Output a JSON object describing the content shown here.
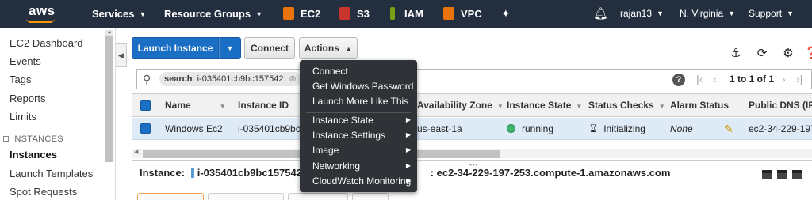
{
  "topnav": {
    "logo": "aws",
    "services": "Services",
    "resource_groups": "Resource Groups",
    "ec2": "EC2",
    "s3": "S3",
    "iam": "IAM",
    "vpc": "VPC",
    "user": "rajan13",
    "region": "N. Virginia",
    "support": "Support"
  },
  "sidebar": {
    "items": [
      "EC2 Dashboard",
      "Events",
      "Tags",
      "Reports",
      "Limits"
    ],
    "section": "INSTANCES",
    "section_items": [
      "Instances",
      "Launch Templates",
      "Spot Requests"
    ]
  },
  "toolbar": {
    "launch": "Launch Instance",
    "connect": "Connect",
    "actions": "Actions"
  },
  "search": {
    "chip_key": "search",
    "chip_value": ": i-035401cb9bc157542"
  },
  "pager": {
    "text": "1 to 1 of 1"
  },
  "table": {
    "headers": [
      "Name",
      "Instance ID",
      "Availability Zone",
      "Instance State",
      "Status Checks",
      "Alarm Status",
      "Public DNS (IPv"
    ],
    "row": {
      "name": "Windows Ec2",
      "instance_id": "i-035401cb9bc1",
      "az": "us-east-1a",
      "state": "running",
      "status": "Initializing",
      "alarm": "None",
      "dns": "ec2-34-229-197-"
    }
  },
  "details": {
    "label": "Instance:",
    "id": "i-035401cb9bc157542 (Wi",
    "dns_tail": ": ec2-34-229-197-253.compute-1.amazonaws.com"
  },
  "menu": {
    "items": [
      "Connect",
      "Get Windows Password",
      "Launch More Like This"
    ],
    "submenus": [
      "Instance State",
      "Instance Settings",
      "Image",
      "Networking",
      "CloudWatch Monitoring"
    ]
  },
  "colors": {
    "nav_bg": "#232f3e",
    "primary": "#1a6ec4",
    "menu_bg": "#2f3236",
    "running": "#3cb371"
  }
}
